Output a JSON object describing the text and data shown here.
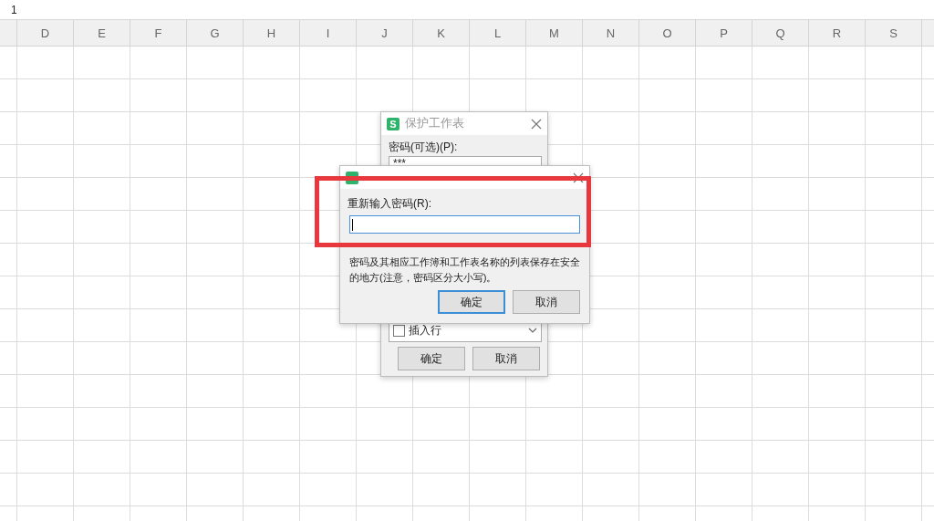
{
  "formula_bar": {
    "value": "1"
  },
  "columns": [
    "D",
    "E",
    "F",
    "G",
    "H",
    "I",
    "J",
    "K",
    "L",
    "M",
    "N",
    "O",
    "P",
    "Q",
    "R",
    "S"
  ],
  "back_dialog": {
    "icon_letter": "S",
    "title": "保护工作表",
    "password_label": "密码(可选)(P):",
    "password_value": "***",
    "permission": {
      "label": "插入行",
      "checked": false
    },
    "buttons": [
      "确定",
      "取消"
    ]
  },
  "dialog": {
    "label": "重新输入密码(R):",
    "warning": "密码及其相应工作簿和工作表名称的列表保存在安全的地方(注意，密码区分大小写)。",
    "buttons": [
      {
        "label": "确定",
        "selected": true
      },
      {
        "label": "取消",
        "selected": false
      }
    ]
  }
}
